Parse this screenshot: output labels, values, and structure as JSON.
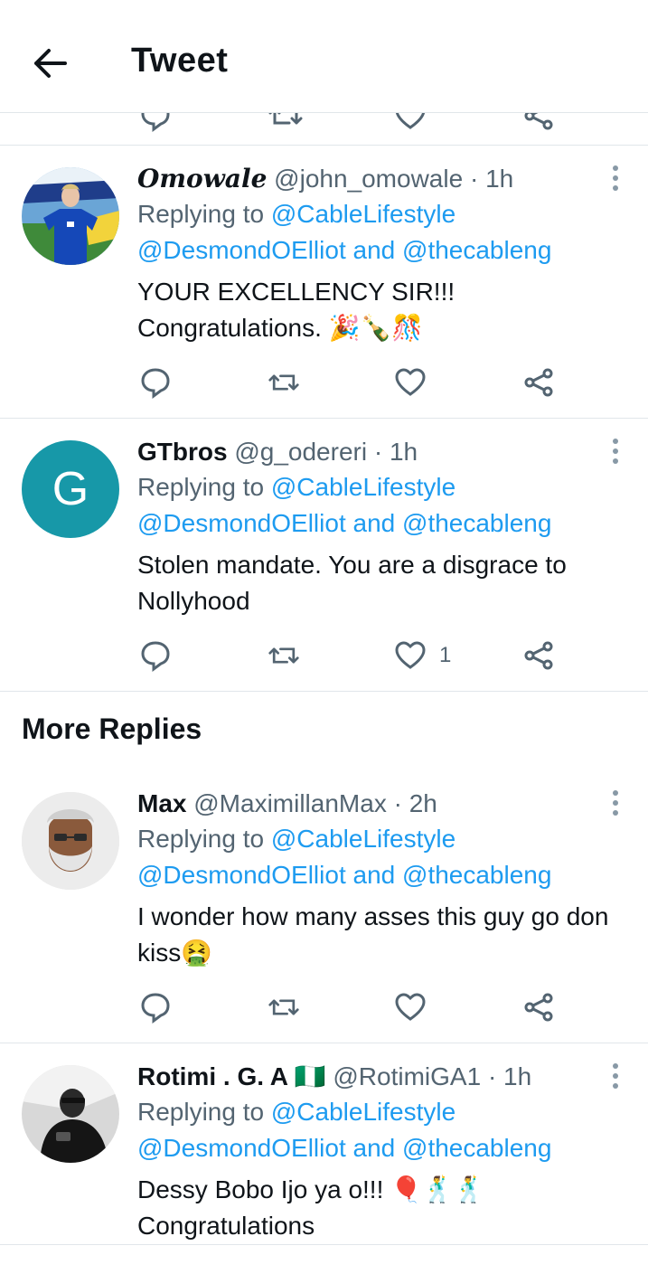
{
  "header": {
    "title": "Tweet"
  },
  "icons": {
    "back": "arrow-left-icon",
    "more": "more-vertical-icon",
    "reply": "reply-icon",
    "retweet": "retweet-icon",
    "like": "heart-icon",
    "share": "share-icon"
  },
  "colors": {
    "link": "#1d9bf0",
    "muted": "#536471",
    "text": "#0f1419",
    "avatar_g": "#1798a8"
  },
  "tweets": [
    {
      "name": "𝑶𝒎𝒐𝒘𝒂𝒍𝒆",
      "handle": "@john_omowale",
      "dot": "·",
      "time": "1h",
      "replying_prefix": "Replying to",
      "mention1": "@CableLifestyle",
      "mention2": "@DesmondOElliot",
      "and": "and",
      "mention3": "@thecableng",
      "text": "YOUR EXCELLENCY SIR!!! Congratulations. 🎉🍾🎊",
      "likes": ""
    },
    {
      "name": "GTbros",
      "handle": "@g_odereri",
      "dot": "·",
      "time": "1h",
      "avatar_letter": "G",
      "replying_prefix": "Replying to",
      "mention1": "@CableLifestyle",
      "mention2": "@DesmondOElliot",
      "and": "and",
      "mention3": "@thecableng",
      "text": "Stolen mandate. You are a disgrace to Nollyhood",
      "likes": "1"
    }
  ],
  "more_replies": {
    "title": "More Replies",
    "tweets": [
      {
        "name": "Max",
        "handle": "@MaximillanMax",
        "dot": "·",
        "time": "2h",
        "replying_prefix": "Replying to",
        "mention1": "@CableLifestyle",
        "mention2": "@DesmondOElliot",
        "and": "and",
        "mention3": "@thecableng",
        "text": "I wonder how many asses this guy go don kiss🤮"
      },
      {
        "name": "Rotimi . G. A 🇳🇬",
        "handle": "@RotimiGA1",
        "dot": "·",
        "time": "1h",
        "replying_prefix": "Replying to",
        "mention1": "@CableLifestyle",
        "mention2": "@DesmondOElliot",
        "and": "and",
        "mention3": "@thecableng",
        "text": "Dessy Bobo Ijo ya o!!! 🎈🕺🕺",
        "text2": "Congratulations"
      }
    ]
  }
}
